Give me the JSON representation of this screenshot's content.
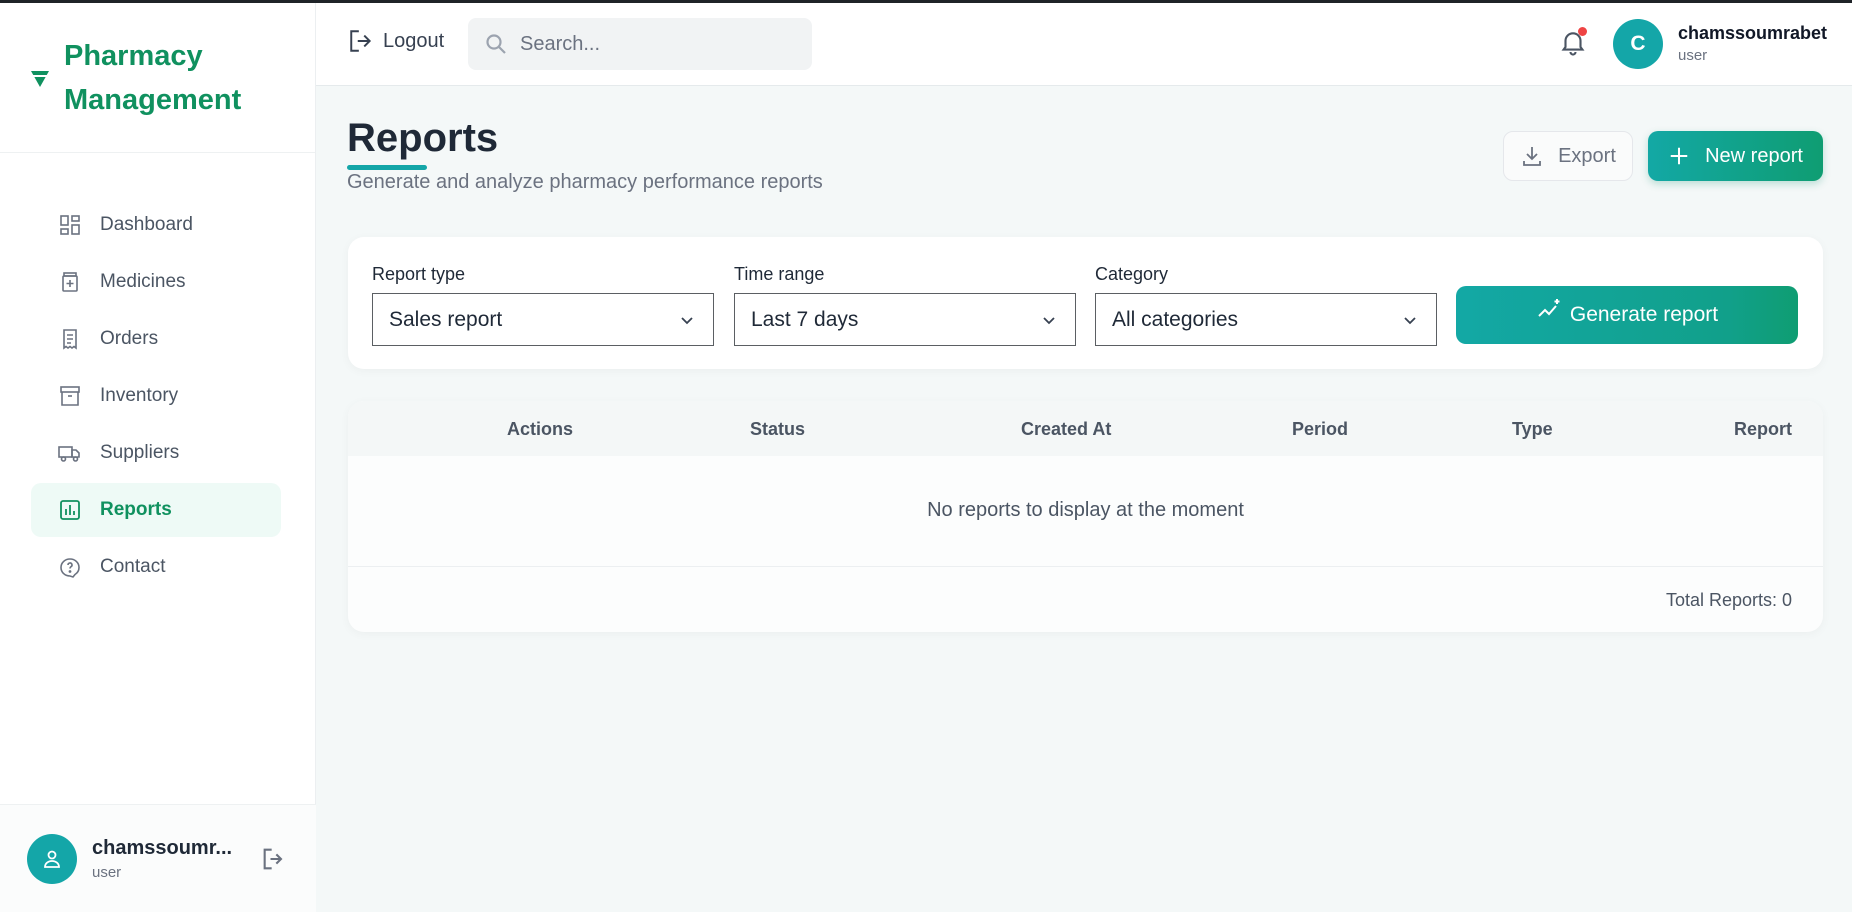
{
  "app": {
    "title": "Pharmacy Management"
  },
  "sidebar": {
    "items": [
      {
        "label": "Dashboard",
        "icon": "dashboard-icon",
        "active": false
      },
      {
        "label": "Medicines",
        "icon": "medicine-icon",
        "active": false
      },
      {
        "label": "Orders",
        "icon": "receipt-icon",
        "active": false
      },
      {
        "label": "Inventory",
        "icon": "archive-icon",
        "active": false
      },
      {
        "label": "Suppliers",
        "icon": "truck-icon",
        "active": false
      },
      {
        "label": "Reports",
        "icon": "bar-chart-icon",
        "active": true
      },
      {
        "label": "Contact",
        "icon": "help-icon",
        "active": false
      }
    ],
    "user": {
      "name": "chamssoumr...",
      "role": "user"
    }
  },
  "header": {
    "logout_label": "Logout",
    "search_placeholder": "Search...",
    "avatar_initial": "C",
    "user_name": "chamssoumrabet",
    "user_role": "user"
  },
  "page": {
    "title": "Reports",
    "subtitle": "Generate and analyze pharmacy performance reports",
    "export_label": "Export",
    "new_report_label": "New report"
  },
  "filters": {
    "report_type": {
      "label": "Report type",
      "value": "Sales report"
    },
    "time_range": {
      "label": "Time range",
      "value": "Last 7 days"
    },
    "category": {
      "label": "Category",
      "value": "All categories"
    },
    "generate_label": "Generate report"
  },
  "table": {
    "columns": [
      "Actions",
      "Status",
      "Created At",
      "Period",
      "Type",
      "Report"
    ],
    "rows": [],
    "empty_message": "No reports to display at the moment",
    "total_label": "Total Reports: 0"
  },
  "colors": {
    "brand": "#10915f",
    "accent": "#14a6a8",
    "notification_dot": "#ef4444"
  }
}
